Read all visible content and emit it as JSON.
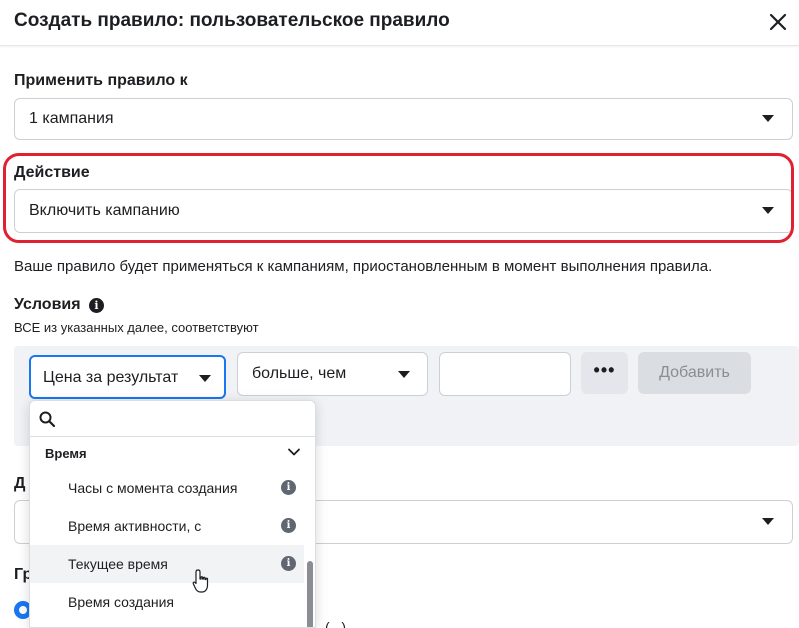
{
  "header": {
    "title": "Создать правило: пользовательское правило"
  },
  "apply": {
    "label": "Применить правило к",
    "value": "1 кампания"
  },
  "action": {
    "label": "Действие",
    "value": "Включить кампанию"
  },
  "note": "Ваше правило будет применяться к кампаниям, приостановленным в момент выполнения правила.",
  "conditions": {
    "label": "Условия",
    "sublabel": "ВСЕ из указанных далее, соответствуют",
    "metric": "Цена за результат",
    "operator": "больше, чем",
    "value": "",
    "more_label": "•••",
    "add_label": "Добавить"
  },
  "hidden_labels": {
    "d": "Д",
    "g": "Гр"
  },
  "dropdown": {
    "search_placeholder": "",
    "group": "Время",
    "items": [
      {
        "label": "Часы с момента создания"
      },
      {
        "label": "Время активности, с"
      },
      {
        "label": "Текущее время"
      },
      {
        "label": "Время создания"
      }
    ]
  },
  "partial_bottom_text": "(...)",
  "colors": {
    "accent": "#1877f2",
    "highlight": "#e02130",
    "panel": "#f0f2f5"
  }
}
